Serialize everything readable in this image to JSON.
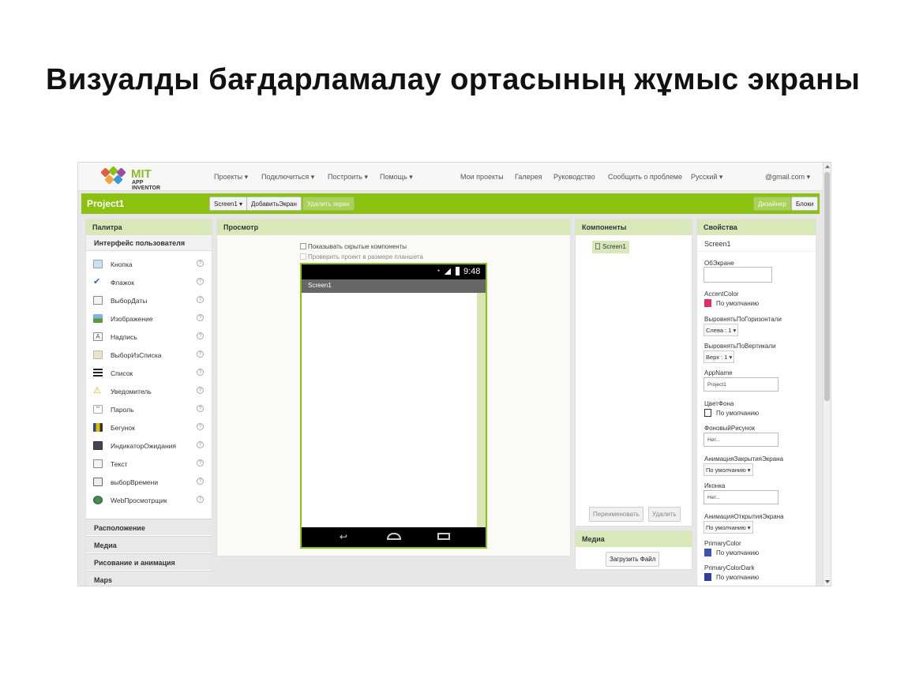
{
  "slide_title": "Визуалды бағдарламалау ортасының жұмыс экраны",
  "logo": {
    "title": "MIT",
    "subtitle": "APP INVENTOR"
  },
  "topnav": {
    "menus": [
      "Проекты ▾",
      "Подключиться ▾",
      "Построить ▾",
      "Помощь ▾"
    ],
    "links": [
      "Мои проекты",
      "Галерея",
      "Руководство",
      "Сообщить о проблеме"
    ],
    "language": "Русский ▾",
    "account": "@gmail.com ▾"
  },
  "projbar": {
    "project_name": "Project1",
    "screen_select": "Screen1 ▾",
    "add_screen": "ДобавитьЭкран",
    "remove_screen": "Удалить экран",
    "designer": "Дизайнер",
    "blocks": "Блоки"
  },
  "palette": {
    "title": "Палитра",
    "group": "Интерфейс пользователя",
    "items": [
      "Кнопка",
      "Флажок",
      "ВыборДаты",
      "Изображение",
      "Надпись",
      "ВыборИзСписка",
      "Список",
      "Уведомитель",
      "Пароль",
      "Бегунок",
      "ИндикаторОжидания",
      "Текст",
      "выборВремени",
      "WebПросмотрщик"
    ],
    "help_glyph": "?",
    "categories": [
      "Расположение",
      "Медиа",
      "Рисование и анимация",
      "Maps"
    ]
  },
  "viewer": {
    "title": "Просмотр",
    "show_hidden": "Показывать скрытые компоненты",
    "tablet_preview": "Проверить проект в размере планшета",
    "status_time": "9:48",
    "screen_title": "Screen1"
  },
  "components": {
    "title": "Компоненты",
    "tree_root": "Screen1",
    "rename": "Переименовать",
    "delete": "Удалить"
  },
  "media": {
    "title": "Медиа",
    "upload": "Загрузить Файл"
  },
  "properties": {
    "title": "Свойства",
    "component": "Screen1",
    "about_label": "ОбЭкране",
    "accent_label": "AccentColor",
    "accent_value": "По умолчанию",
    "accent_color": "#e0306b",
    "halign_label": "ВыровнятьПоГоризонтали",
    "halign_value": "Слева : 1 ▾",
    "valign_label": "ВыровнятьПоВертикали",
    "valign_value": "Верх : 1 ▾",
    "appname_label": "AppName",
    "appname_value": "Project1",
    "bgcolor_label": "ЦветФона",
    "bgcolor_value": "По умолчанию",
    "bgimage_label": "ФоновыйРисунок",
    "bgimage_value": "Нет...",
    "close_anim_label": "АнимацияЗакрытияЭкрана",
    "close_anim_value": "По умолчанию ▾",
    "icon_label": "Иконка",
    "icon_value": "Нет...",
    "open_anim_label": "АнимацияОткрытияЭкрана",
    "open_anim_value": "По умолчанию ▾",
    "primary_label": "PrimaryColor",
    "primary_value": "По умолчанию",
    "primary_color": "#3f51b5",
    "primary_dark_label": "PrimaryColorDark",
    "primary_dark_value": "По умолчанию",
    "primary_dark_color": "#303f9f"
  },
  "colors": {
    "brand_green": "#8bc10f",
    "panel_header": "#d9e8b9"
  }
}
